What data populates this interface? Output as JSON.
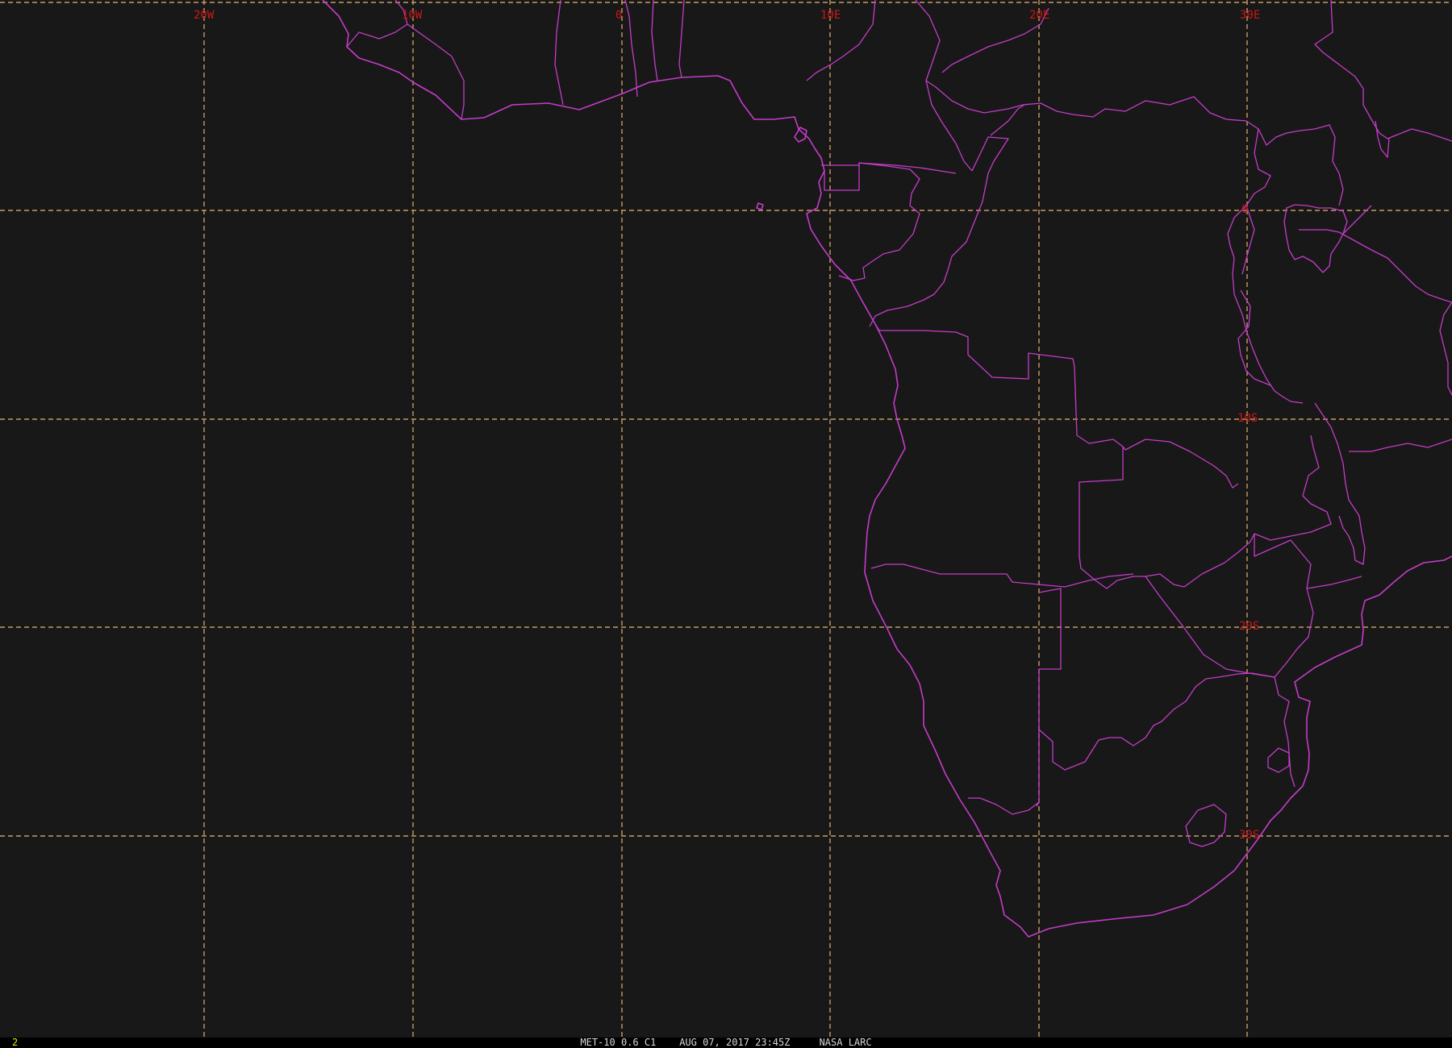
{
  "image": {
    "satellite_caption": "MET-10 0.6 C1    AUG 07, 2017 23:45Z     NASA LARC",
    "frame_number": "2",
    "background_color": "#181818",
    "grid_color": "#c99a63",
    "boundary_color": "#c43cc8",
    "label_color": "#c81818"
  },
  "grid": {
    "longitude_labels": [
      "20W",
      "10W",
      "0",
      "10E",
      "20E",
      "30E"
    ],
    "latitude_labels": [
      "0",
      "10S",
      "20S",
      "30S"
    ]
  },
  "icons": {
    "coastline": "country-boundary-lines",
    "graticule": "dashed-grid-lines"
  }
}
